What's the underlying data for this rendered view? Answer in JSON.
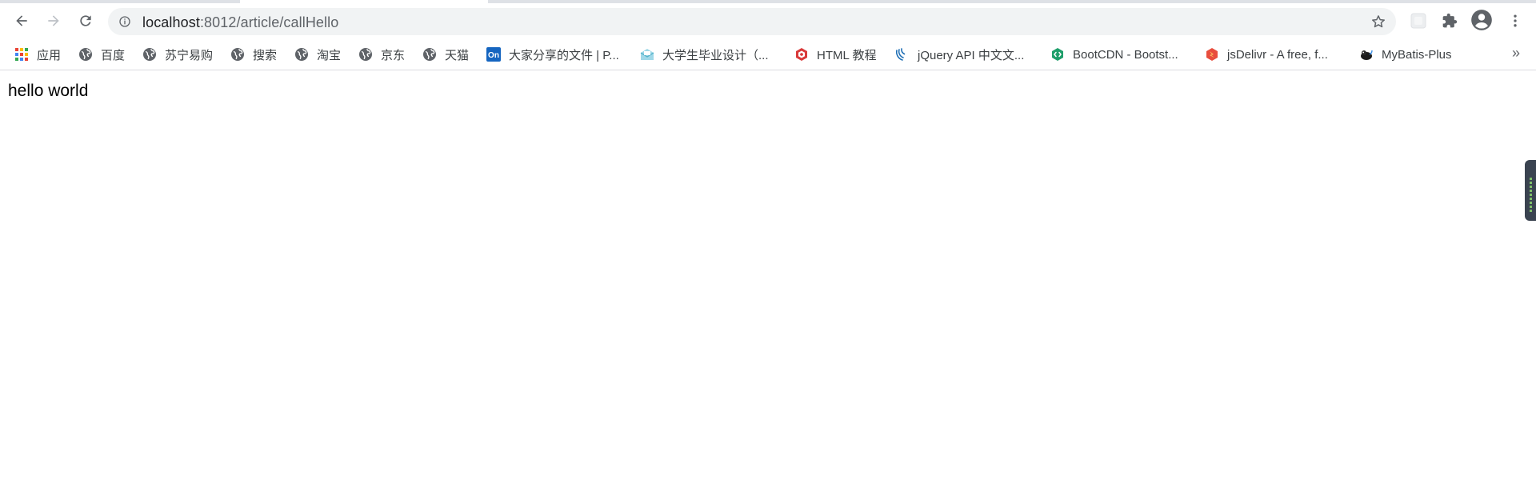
{
  "browser": {
    "url_host": "localhost",
    "url_path": ":8012/article/callHello",
    "icons": {
      "back": "arrow-left-icon",
      "forward": "arrow-right-icon",
      "reload": "reload-icon",
      "info": "info-icon",
      "bookmark_star": "star-icon",
      "extension_placeholder": "extension-placeholder-icon",
      "extensions": "puzzle-icon",
      "profile": "profile-icon",
      "menu": "kebab-menu-icon"
    }
  },
  "bookmarks": {
    "items": [
      {
        "label": "应用",
        "icon": "apps-grid-icon"
      },
      {
        "label": "百度",
        "icon": "globe-icon"
      },
      {
        "label": "苏宁易购",
        "icon": "globe-icon"
      },
      {
        "label": "搜索",
        "icon": "globe-icon"
      },
      {
        "label": "淘宝",
        "icon": "globe-icon"
      },
      {
        "label": "京东",
        "icon": "globe-icon"
      },
      {
        "label": "天猫",
        "icon": "globe-icon"
      },
      {
        "label": "大家分享的文件 | P...",
        "icon": "on-logo-icon"
      },
      {
        "label": "大学生毕业设计（...",
        "icon": "mail-logo-icon"
      },
      {
        "label": "HTML 教程",
        "icon": "runoob-logo-icon"
      },
      {
        "label": "jQuery API 中文文...",
        "icon": "jquery-logo-icon"
      },
      {
        "label": "BootCDN - Bootst...",
        "icon": "bootcdn-logo-icon"
      },
      {
        "label": "jsDelivr - A free, f...",
        "icon": "jsdelivr-logo-icon"
      },
      {
        "label": "MyBatis-Plus",
        "icon": "mybatis-logo-icon"
      }
    ],
    "more_label": "»"
  },
  "page": {
    "content_text": "hello world"
  },
  "colors": {
    "omnibox_bg": "#f1f3f4",
    "icon_gray": "#5f6368",
    "text_dark": "#202124"
  }
}
